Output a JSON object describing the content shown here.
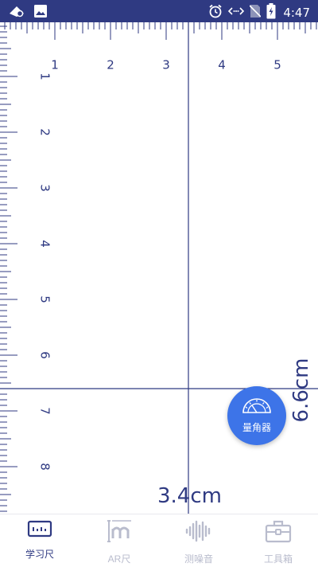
{
  "status_bar": {
    "time": "4:47",
    "left_icons": [
      "app-notification-icon",
      "image-icon"
    ],
    "right_icons": [
      "alarm-icon",
      "data-transfer-icon",
      "no-sim-icon",
      "battery-charging-icon"
    ]
  },
  "ruler": {
    "top_labels": [
      "1",
      "2",
      "3",
      "4",
      "5"
    ],
    "left_labels": [
      "1",
      "2",
      "3",
      "4",
      "5",
      "6",
      "7",
      "8"
    ],
    "crosshair": {
      "x_cm": 3.4,
      "y_cm": 6.6
    },
    "x_readout": "3.4cm",
    "y_readout": "6.6cm",
    "color": "#2f3a82"
  },
  "fab": {
    "label": "量角器",
    "icon": "protractor-icon",
    "color": "#3d74e8"
  },
  "nav": {
    "items": [
      {
        "label": "学习尺",
        "icon": "ruler-icon",
        "active": true
      },
      {
        "label": "AR尺",
        "icon": "ar-ruler-icon",
        "active": false
      },
      {
        "label": "测噪音",
        "icon": "sound-wave-icon",
        "active": false
      },
      {
        "label": "工具箱",
        "icon": "toolbox-icon",
        "active": false
      }
    ],
    "active_color": "#2f3a82",
    "inactive_color": "#b9bccd"
  }
}
